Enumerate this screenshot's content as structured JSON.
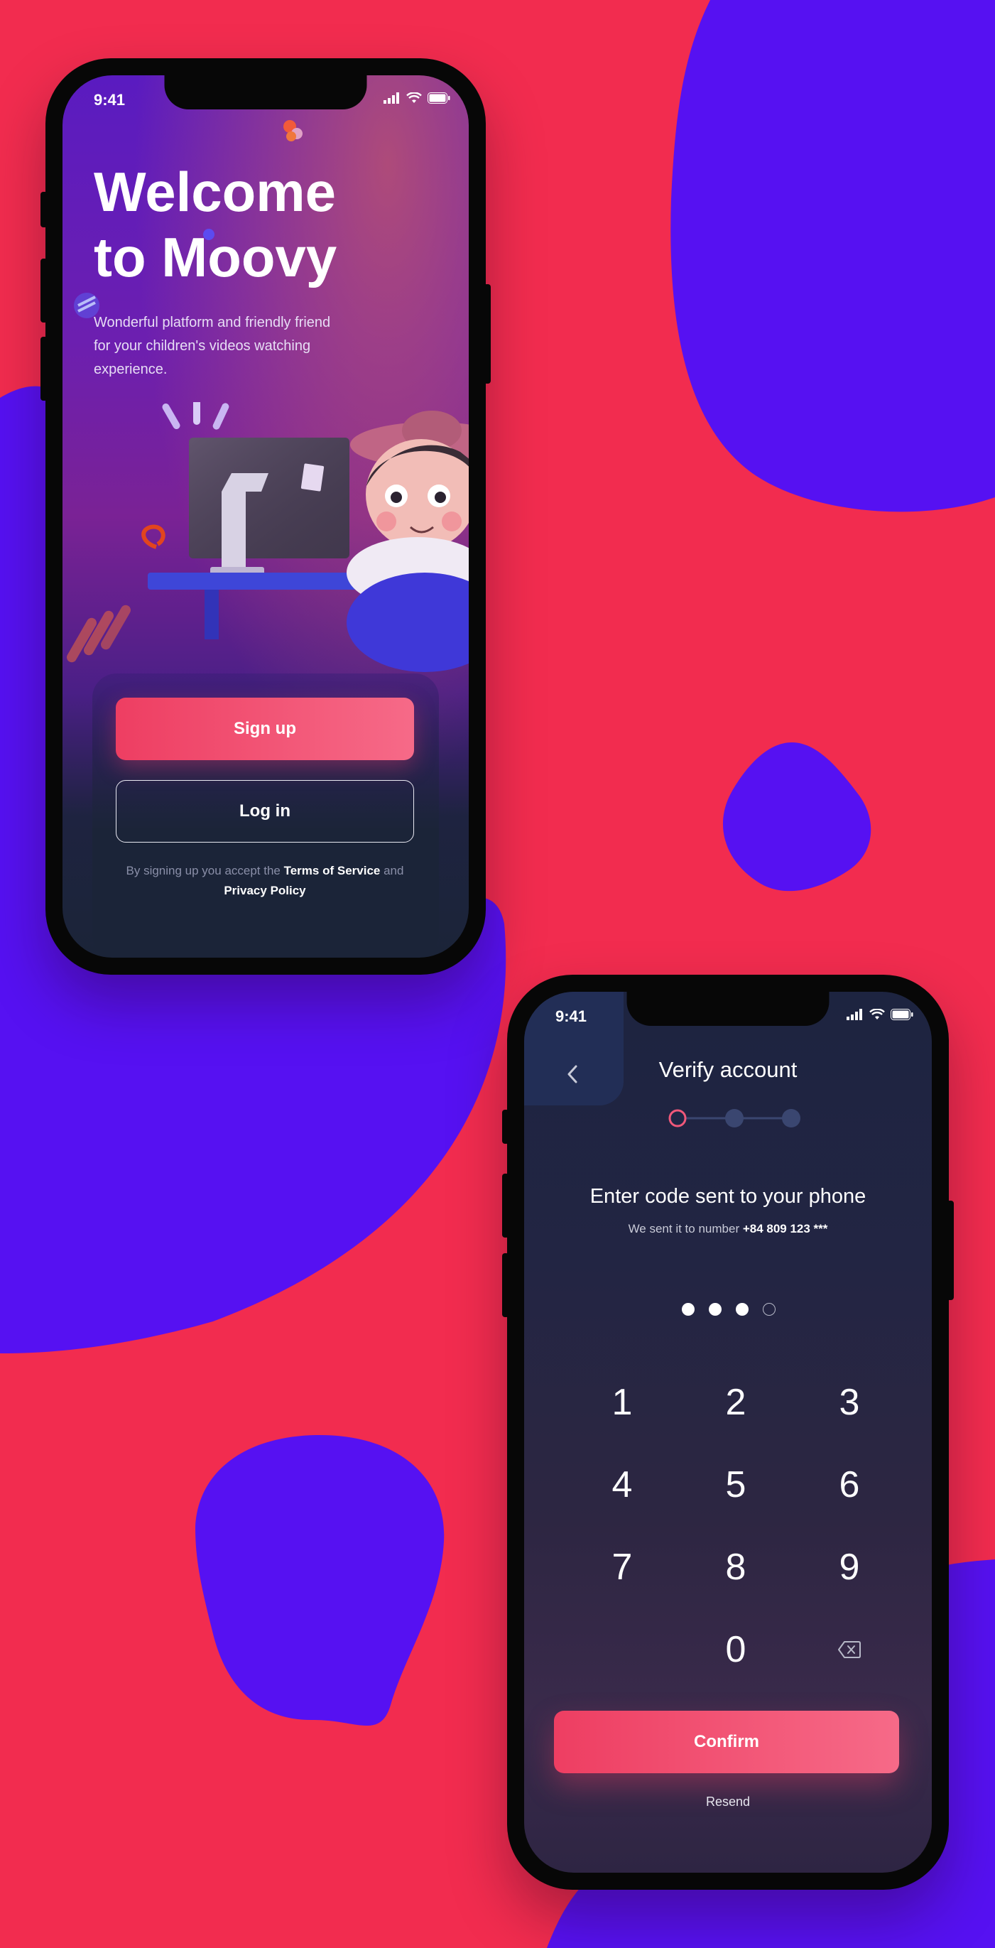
{
  "colors": {
    "background": "#F22C4F",
    "blob": "#5611F2",
    "primary_button": "#EE3E62",
    "dark_surface": "#1B2438"
  },
  "welcome_screen": {
    "status_time": "9:41",
    "title_line1": "Welcome",
    "title_line2": "to Moovy",
    "subtitle": "Wonderful platform and friendly friend for your children's videos watching experience.",
    "signup_label": "Sign up",
    "login_label": "Log in",
    "terms_prefix": "By signing up you accept the ",
    "terms_link": "Terms of Service",
    "terms_and": " and ",
    "privacy_link": "Privacy Policy",
    "status_icons": [
      "signal-icon",
      "wifi-icon",
      "battery-icon"
    ]
  },
  "verify_screen": {
    "status_time": "9:41",
    "title": "Verify account",
    "back_icon": "chevron-left-icon",
    "stepper": {
      "steps": 3,
      "current": 1
    },
    "heading": "Enter code sent to your phone",
    "sent_prefix": "We sent it to number ",
    "phone_number": "+84 809 123 ***",
    "pin": {
      "length": 4,
      "filled": 3
    },
    "keys": [
      "1",
      "2",
      "3",
      "4",
      "5",
      "6",
      "7",
      "8",
      "9",
      "",
      "0",
      "backspace"
    ],
    "confirm_label": "Confirm",
    "resend_label": "Resend"
  }
}
